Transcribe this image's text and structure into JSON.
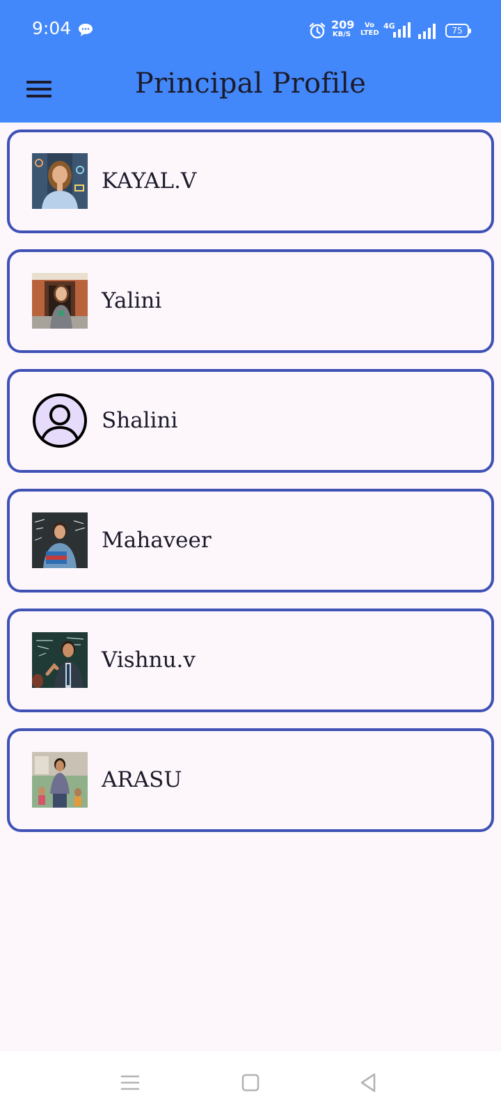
{
  "status_bar": {
    "time": "9:04",
    "net_speed_value": "209",
    "net_speed_unit": "KB/S",
    "volte_line1": "Vo",
    "volte_line2": "LTED",
    "network_type": "4G",
    "battery": "75"
  },
  "app_bar": {
    "title": "Principal Profile"
  },
  "profiles": [
    {
      "name": "KAYAL.V",
      "avatar": "photo-woman-classroom"
    },
    {
      "name": "Yalini",
      "avatar": "photo-woman-school-entrance"
    },
    {
      "name": "Shalini",
      "avatar": "default-person-icon"
    },
    {
      "name": "Mahaveer",
      "avatar": "photo-man-holding-books"
    },
    {
      "name": "Vishnu.v",
      "avatar": "photo-man-chalkboard"
    },
    {
      "name": "ARASU",
      "avatar": "photo-man-playground"
    }
  ],
  "navigation_bar": {
    "buttons": [
      "recent-apps-icon",
      "home-icon",
      "back-icon"
    ]
  },
  "colors": {
    "app_bar": "#4388fb",
    "card_border": "#3f51b5",
    "background": "#fdf7fc",
    "text": "#1c1b2b"
  }
}
